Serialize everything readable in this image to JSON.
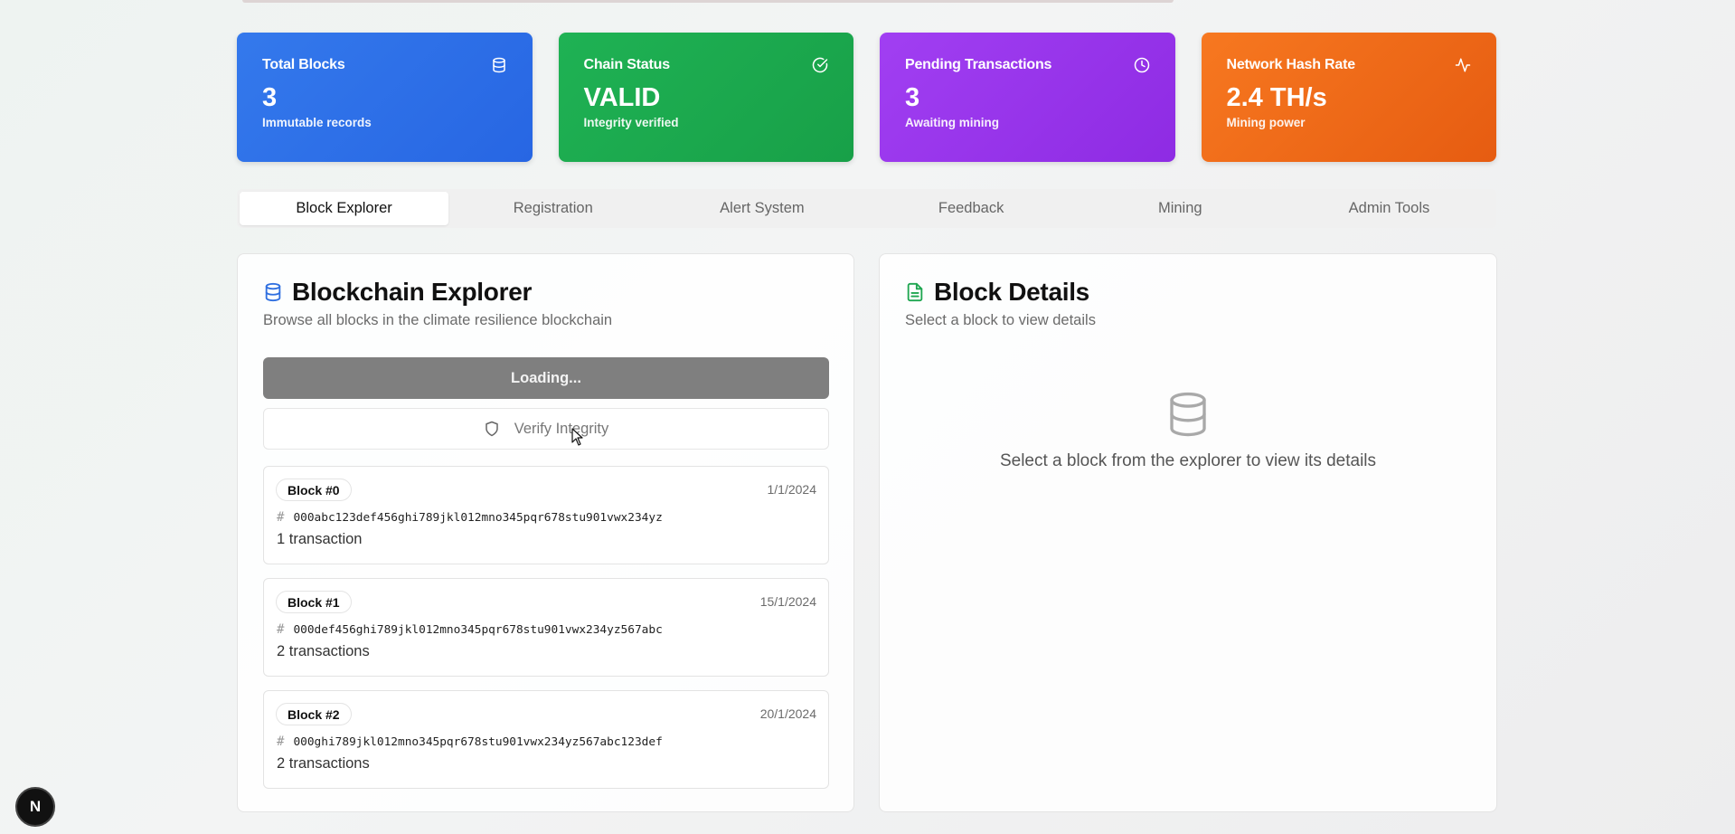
{
  "stats": [
    {
      "title": "Total Blocks",
      "value": "3",
      "subtitle": "Immutable records",
      "icon": "database-icon",
      "color": "#2f72ea"
    },
    {
      "title": "Chain Status",
      "value": "VALID",
      "subtitle": "Integrity verified",
      "icon": "check-circle-icon",
      "color": "#1caa4f"
    },
    {
      "title": "Pending Transactions",
      "value": "3",
      "subtitle": "Awaiting mining",
      "icon": "clock-icon",
      "color": "#9937ec"
    },
    {
      "title": "Network Hash Rate",
      "value": "2.4 TH/s",
      "subtitle": "Mining power",
      "icon": "activity-icon",
      "color": "#f06d1b"
    }
  ],
  "tabs": [
    {
      "label": "Block Explorer",
      "active": true
    },
    {
      "label": "Registration",
      "active": false
    },
    {
      "label": "Alert System",
      "active": false
    },
    {
      "label": "Feedback",
      "active": false
    },
    {
      "label": "Mining",
      "active": false
    },
    {
      "label": "Admin Tools",
      "active": false
    }
  ],
  "explorer": {
    "title": "Blockchain Explorer",
    "description": "Browse all blocks in the climate resilience blockchain",
    "loading_label": "Loading...",
    "verify_label": "Verify Integrity",
    "blocks": [
      {
        "badge": "Block #0",
        "date": "1/1/2024",
        "hash": "000abc123def456ghi789jkl012mno345pqr678stu901vwx234yz",
        "tx": "1 transaction"
      },
      {
        "badge": "Block #1",
        "date": "15/1/2024",
        "hash": "000def456ghi789jkl012mno345pqr678stu901vwx234yz567abc",
        "tx": "2 transactions"
      },
      {
        "badge": "Block #2",
        "date": "20/1/2024",
        "hash": "000ghi789jkl012mno345pqr678stu901vwx234yz567abc123def",
        "tx": "2 transactions"
      }
    ]
  },
  "details": {
    "title": "Block Details",
    "description": "Select a block to view details",
    "empty_text": "Select a block from the explorer to view its details"
  },
  "dev_badge": "N"
}
